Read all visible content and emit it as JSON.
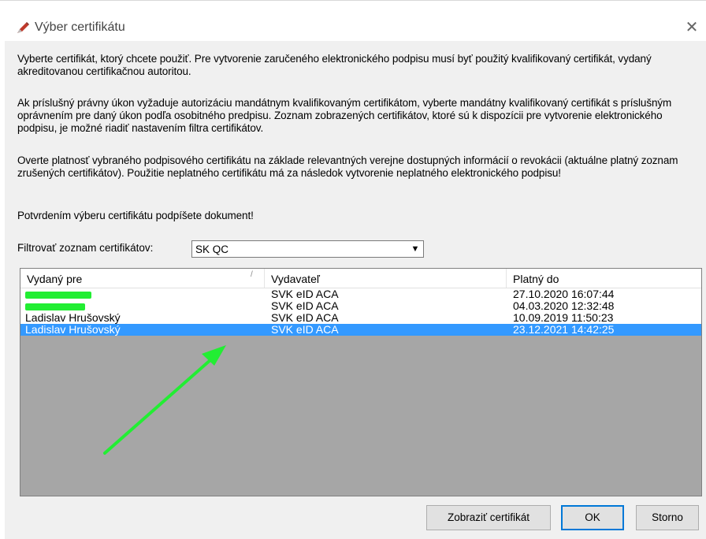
{
  "window": {
    "title": "Výber certifikátu",
    "close_glyph": "✕",
    "icon": "pen-icon"
  },
  "instructions": {
    "p1": "Vyberte certifikát, ktorý chcete použiť. Pre vytvorenie zaručeného elektronického podpisu musí byť použitý kvalifikovaný certifikát, vydaný akreditovanou certifikačnou autoritou.",
    "p2": "Ak príslušný právny úkon vyžaduje autorizáciu mandátnym kvalifikovaným certifikátom, vyberte mandátny kvalifikovaný certifikát s príslušným oprávnením pre daný úkon podľa osobitného predpisu. Zoznam zobrazených certifikátov, ktoré sú k dispozícii pre vytvorenie elektronického podpisu, je možné riadiť nastavením filtra certifikátov.",
    "p3": "Overte platnosť vybraného podpisového certifikátu na základe relevantných verejne dostupných informácií o revokácii (aktuálne platný zoznam zrušených certifikátov). Použitie neplatného certifikátu má za následok vytvorenie neplatného elektronického podpisu!",
    "p4": "Potvrdením výberu certifikátu podpíšete dokument!"
  },
  "filter": {
    "label": "Filtrovať zoznam certifikátov:",
    "selected": "SK QC",
    "arrow_glyph": "▼"
  },
  "list": {
    "columns": [
      "Vydaný pre",
      "Vydavateľ",
      "Platný do"
    ],
    "sort_glyph": "/",
    "rows": [
      {
        "issued_to": "",
        "issuer": "SVK eID ACA",
        "valid_to": "27.10.2020 16:07:44",
        "redacted": true
      },
      {
        "issued_to": "",
        "issuer": "SVK eID ACA",
        "valid_to": "04.03.2020 12:32:48",
        "redacted": true
      },
      {
        "issued_to": "Ladislav Hrušovský",
        "issuer": "SVK eID ACA",
        "valid_to": "10.09.2019 11:50:23"
      },
      {
        "issued_to": "Ladislav Hrušovský",
        "issuer": "SVK eID ACA",
        "valid_to": "23.12.2021 14:42:25",
        "selected": true
      }
    ],
    "background_color": "#a6a6a6",
    "selection_color": "#3399ff"
  },
  "annotation": {
    "color": "#22ee33",
    "shape": "arrow"
  },
  "buttons": {
    "show_certificate": "Zobraziť certifikát",
    "ok": "OK",
    "cancel": "Storno"
  }
}
